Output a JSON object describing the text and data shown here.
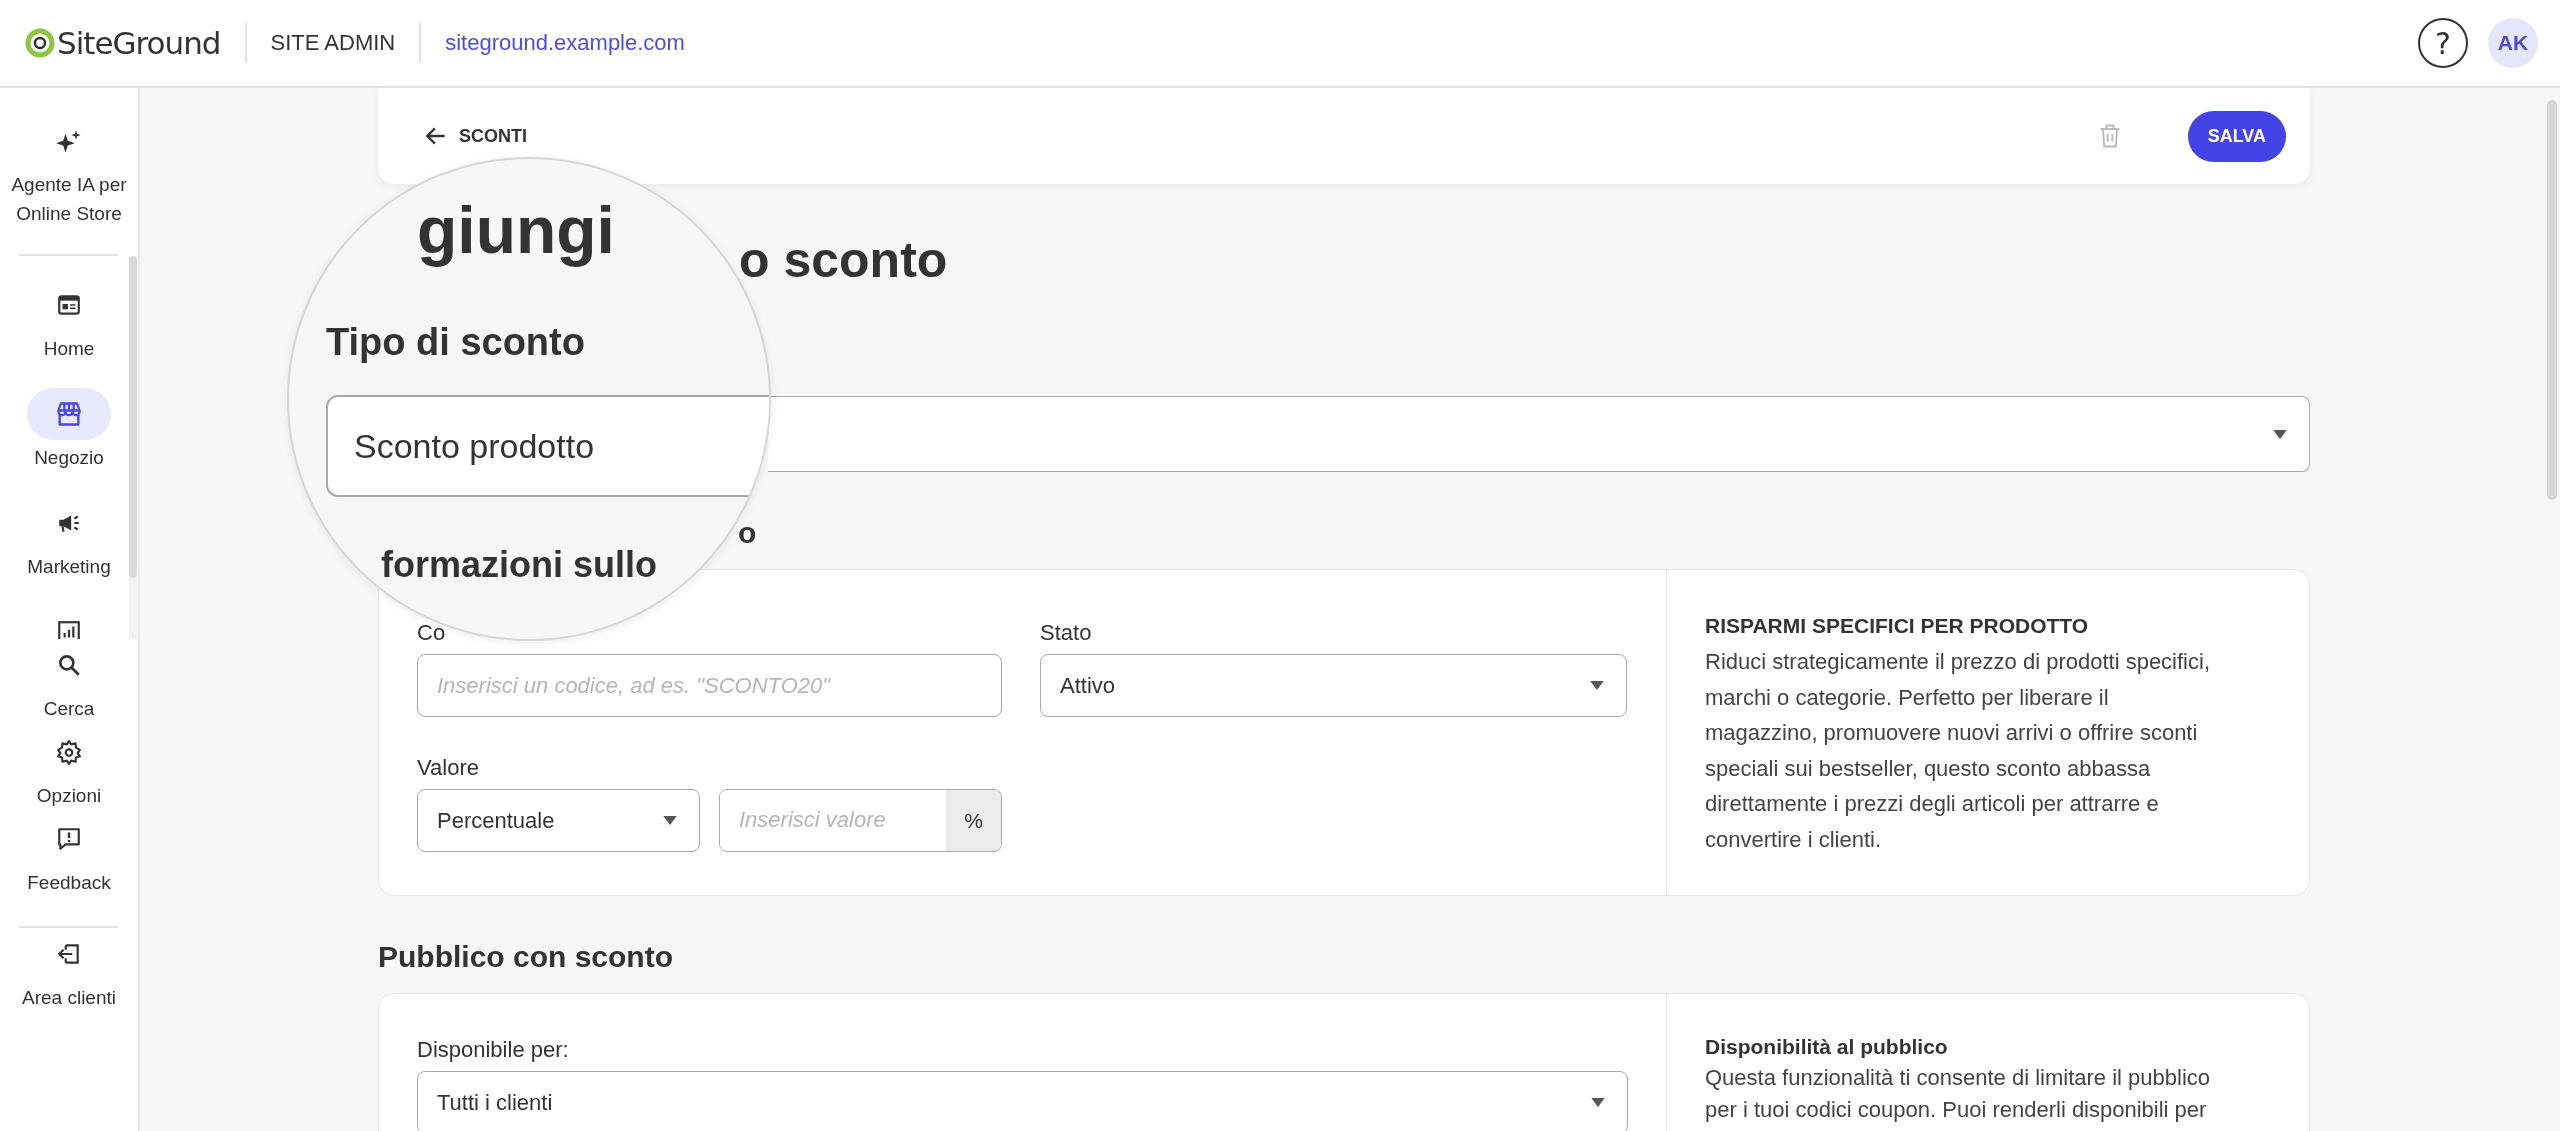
{
  "header": {
    "logo": "SiteGround",
    "section": "SITE ADMIN",
    "domain": "siteground.example.com",
    "help": "?",
    "avatar": "AK"
  },
  "sidebar": {
    "assistant": {
      "label": "Agente IA per Online Store"
    },
    "nav": [
      {
        "label": "Home",
        "selected": false
      },
      {
        "label": "Negozio",
        "selected": true
      },
      {
        "label": "Marketing",
        "selected": false
      }
    ],
    "tools": [
      {
        "label": "Cerca",
        "selected": false
      },
      {
        "label": "Opzioni",
        "selected": false
      },
      {
        "label": "Feedback",
        "selected": false
      }
    ],
    "footer": {
      "label": "Area clienti"
    }
  },
  "toolbar": {
    "back": "SCONTI",
    "save": "SALVA"
  },
  "title": "o sconto",
  "magnifier": {
    "title": "giungi",
    "label": "Tipo di sconto",
    "value": "Sconto prodotto",
    "section": "formazioni sullo"
  },
  "info": {
    "heading": "o",
    "code": {
      "label": "Co",
      "placeholder": "Inserisci un codice, ad es. \"SCONTO20\""
    },
    "status": {
      "label": "Stato",
      "value": "Attivo"
    },
    "value": {
      "label": "Valore",
      "type": "Percentuale",
      "placeholder": "Inserisci valore",
      "unit": "%"
    },
    "help": {
      "title": "RISPARMI SPECIFICI PER PRODOTTO",
      "lines": [
        "Riduci strategicamente il prezzo di prodotti specifici,",
        "marchi o categorie. Perfetto per liberare il",
        "magazzino, promuovere nuovi arrivi o offrire sconti",
        "speciali sui bestseller, questo sconto abbassa",
        "direttamente i prezzi degli articoli per attrarre e",
        "convertire i clienti."
      ]
    }
  },
  "audience": {
    "heading": "Pubblico con sconto",
    "available": {
      "label": "Disponibile per:",
      "value": "Tutti i clienti"
    },
    "help": {
      "title": "Disponibilità al pubblico",
      "lines": [
        "Questa funzionalità ti consente di limitare il pubblico",
        "per i tuoi codici coupon. Puoi renderli disponibili per"
      ]
    }
  }
}
